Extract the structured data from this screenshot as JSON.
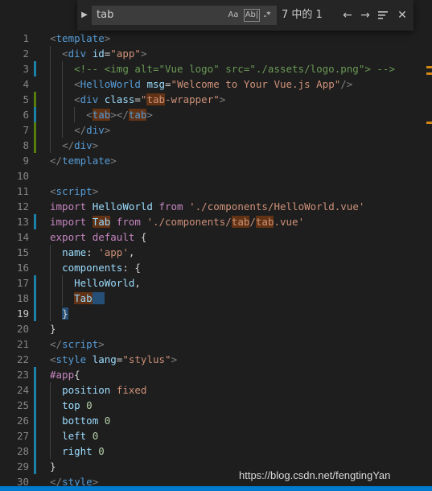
{
  "find_widget": {
    "search_value": "tab",
    "match_case_label": "Aa",
    "whole_word_label": "Ab|",
    "regex_label": ".*",
    "result_count": "7 中的 1"
  },
  "watermark": "https://blog.csdn.net/fengtingYan",
  "colors": {
    "background": "#1e1e1e",
    "find_highlight": "#613214",
    "selection": "#264f78",
    "modified_gutter": "#1b81a8",
    "added_gutter": "#587c0c"
  },
  "lines": [
    {
      "n": "1",
      "tokens": [
        [
          "<",
          "t-punct"
        ],
        [
          "template",
          "t-tag"
        ],
        [
          ">",
          "t-punct"
        ]
      ]
    },
    {
      "n": "2",
      "tokens": [
        [
          "  ",
          "t-plain"
        ],
        [
          "<",
          "t-punct"
        ],
        [
          "div",
          "t-tag"
        ],
        [
          " ",
          "t-plain"
        ],
        [
          "id",
          "t-attr"
        ],
        [
          "=",
          "t-plain"
        ],
        [
          "\"app\"",
          "t-str"
        ],
        [
          ">",
          "t-punct"
        ]
      ]
    },
    {
      "n": "3",
      "tokens": [
        [
          "    ",
          "t-plain"
        ],
        [
          "<!-- <img alt=\"Vue logo\" src=\"./assets/logo.png\"> -->",
          "t-comment"
        ]
      ]
    },
    {
      "n": "4",
      "tokens": [
        [
          "    ",
          "t-plain"
        ],
        [
          "<",
          "t-punct"
        ],
        [
          "HelloWorld",
          "t-tag"
        ],
        [
          " ",
          "t-plain"
        ],
        [
          "msg",
          "t-attr"
        ],
        [
          "=",
          "t-plain"
        ],
        [
          "\"Welcome to Your Vue.js App\"",
          "t-str"
        ],
        [
          "/>",
          "t-punct"
        ]
      ]
    },
    {
      "n": "5",
      "tokens": [
        [
          "    ",
          "t-plain"
        ],
        [
          "<",
          "t-punct"
        ],
        [
          "div",
          "t-tag"
        ],
        [
          " ",
          "t-plain"
        ],
        [
          "class",
          "t-attr"
        ],
        [
          "=",
          "t-plain"
        ],
        [
          "\"",
          "t-str"
        ],
        [
          "tab",
          "t-str hl"
        ],
        [
          "-wrapper\"",
          "t-str"
        ],
        [
          ">",
          "t-punct"
        ]
      ]
    },
    {
      "n": "6",
      "tokens": [
        [
          "      ",
          "t-plain"
        ],
        [
          "<",
          "t-punct"
        ],
        [
          "tab",
          "t-tag hl"
        ],
        [
          "></",
          "t-punct"
        ],
        [
          "tab",
          "t-tag hl"
        ],
        [
          ">",
          "t-punct"
        ]
      ]
    },
    {
      "n": "7",
      "tokens": [
        [
          "    ",
          "t-plain"
        ],
        [
          "</",
          "t-punct"
        ],
        [
          "div",
          "t-tag"
        ],
        [
          ">",
          "t-punct"
        ]
      ]
    },
    {
      "n": "8",
      "tokens": [
        [
          "  ",
          "t-plain"
        ],
        [
          "</",
          "t-punct"
        ],
        [
          "div",
          "t-tag"
        ],
        [
          ">",
          "t-punct"
        ]
      ]
    },
    {
      "n": "9",
      "tokens": [
        [
          "</",
          "t-punct"
        ],
        [
          "template",
          "t-tag"
        ],
        [
          ">",
          "t-punct"
        ]
      ]
    },
    {
      "n": "10",
      "tokens": []
    },
    {
      "n": "11",
      "tokens": [
        [
          "<",
          "t-punct"
        ],
        [
          "script",
          "t-tag"
        ],
        [
          ">",
          "t-punct"
        ]
      ]
    },
    {
      "n": "12",
      "tokens": [
        [
          "import",
          "t-kw"
        ],
        [
          " ",
          "t-plain"
        ],
        [
          "HelloWorld",
          "t-var"
        ],
        [
          " ",
          "t-plain"
        ],
        [
          "from",
          "t-kw"
        ],
        [
          " ",
          "t-plain"
        ],
        [
          "'./components/HelloWorld.vue'",
          "t-str"
        ]
      ]
    },
    {
      "n": "13",
      "tokens": [
        [
          "import",
          "t-kw"
        ],
        [
          " ",
          "t-plain"
        ],
        [
          "Tab",
          "t-var hl"
        ],
        [
          " ",
          "t-plain"
        ],
        [
          "from",
          "t-kw"
        ],
        [
          " ",
          "t-plain"
        ],
        [
          "'./components/",
          "t-str"
        ],
        [
          "tab",
          "t-str hl"
        ],
        [
          "/",
          "t-str"
        ],
        [
          "tab",
          "t-str hl"
        ],
        [
          ".vue'",
          "t-str"
        ]
      ]
    },
    {
      "n": "14",
      "tokens": [
        [
          "export",
          "t-kw"
        ],
        [
          " ",
          "t-plain"
        ],
        [
          "default",
          "t-kw"
        ],
        [
          " {",
          "t-plain"
        ]
      ]
    },
    {
      "n": "15",
      "tokens": [
        [
          "  ",
          "t-plain"
        ],
        [
          "name",
          "t-var"
        ],
        [
          ": ",
          "t-plain"
        ],
        [
          "'app'",
          "t-str"
        ],
        [
          ",",
          "t-plain"
        ]
      ]
    },
    {
      "n": "16",
      "tokens": [
        [
          "  ",
          "t-plain"
        ],
        [
          "components",
          "t-var"
        ],
        [
          ": {",
          "t-plain"
        ]
      ]
    },
    {
      "n": "17",
      "tokens": [
        [
          "    ",
          "t-plain"
        ],
        [
          "HelloWorld",
          "t-var"
        ],
        [
          ",",
          "t-plain"
        ]
      ]
    },
    {
      "n": "18",
      "tokens": [
        [
          "    ",
          "t-plain"
        ],
        [
          "Tab",
          "t-var hl"
        ],
        [
          "  ",
          "t-plain sel"
        ]
      ]
    },
    {
      "n": "19",
      "tokens": [
        [
          "  ",
          "t-plain"
        ],
        [
          "}",
          "t-plain sel"
        ]
      ]
    },
    {
      "n": "20",
      "tokens": [
        [
          "}",
          "t-plain"
        ]
      ]
    },
    {
      "n": "21",
      "tokens": [
        [
          "</",
          "t-punct"
        ],
        [
          "script",
          "t-tag"
        ],
        [
          ">",
          "t-punct"
        ]
      ]
    },
    {
      "n": "22",
      "tokens": [
        [
          "<",
          "t-punct"
        ],
        [
          "style",
          "t-tag"
        ],
        [
          " ",
          "t-plain"
        ],
        [
          "lang",
          "t-attr"
        ],
        [
          "=",
          "t-plain"
        ],
        [
          "\"stylus\"",
          "t-str"
        ],
        [
          ">",
          "t-punct"
        ]
      ]
    },
    {
      "n": "23",
      "tokens": [
        [
          "#app",
          "t-kw"
        ],
        [
          "{",
          "t-plain"
        ]
      ]
    },
    {
      "n": "24",
      "tokens": [
        [
          "  ",
          "t-plain"
        ],
        [
          "position",
          "t-var"
        ],
        [
          " ",
          "t-plain"
        ],
        [
          "fixed",
          "t-str"
        ]
      ]
    },
    {
      "n": "25",
      "tokens": [
        [
          "  ",
          "t-plain"
        ],
        [
          "top",
          "t-var"
        ],
        [
          " ",
          "t-plain"
        ],
        [
          "0",
          "t-num"
        ]
      ]
    },
    {
      "n": "26",
      "tokens": [
        [
          "  ",
          "t-plain"
        ],
        [
          "bottom",
          "t-var"
        ],
        [
          " ",
          "t-plain"
        ],
        [
          "0",
          "t-num"
        ]
      ]
    },
    {
      "n": "27",
      "tokens": [
        [
          "  ",
          "t-plain"
        ],
        [
          "left",
          "t-var"
        ],
        [
          " ",
          "t-plain"
        ],
        [
          "0",
          "t-num"
        ]
      ]
    },
    {
      "n": "28",
      "tokens": [
        [
          "  ",
          "t-plain"
        ],
        [
          "right",
          "t-var"
        ],
        [
          " ",
          "t-plain"
        ],
        [
          "0",
          "t-num"
        ]
      ]
    },
    {
      "n": "29",
      "tokens": [
        [
          "}",
          "t-plain"
        ]
      ]
    },
    {
      "n": "30",
      "tokens": [
        [
          "</",
          "t-punct"
        ],
        [
          "style",
          "t-tag"
        ],
        [
          ">",
          "t-punct"
        ]
      ]
    }
  ],
  "active_line": "19",
  "modified_lines": [
    "3",
    "6",
    "13",
    "17",
    "18",
    "19",
    "23",
    "24",
    "25",
    "26",
    "27",
    "28",
    "29"
  ],
  "added_lines": [
    "5",
    "6",
    "7",
    "8"
  ]
}
